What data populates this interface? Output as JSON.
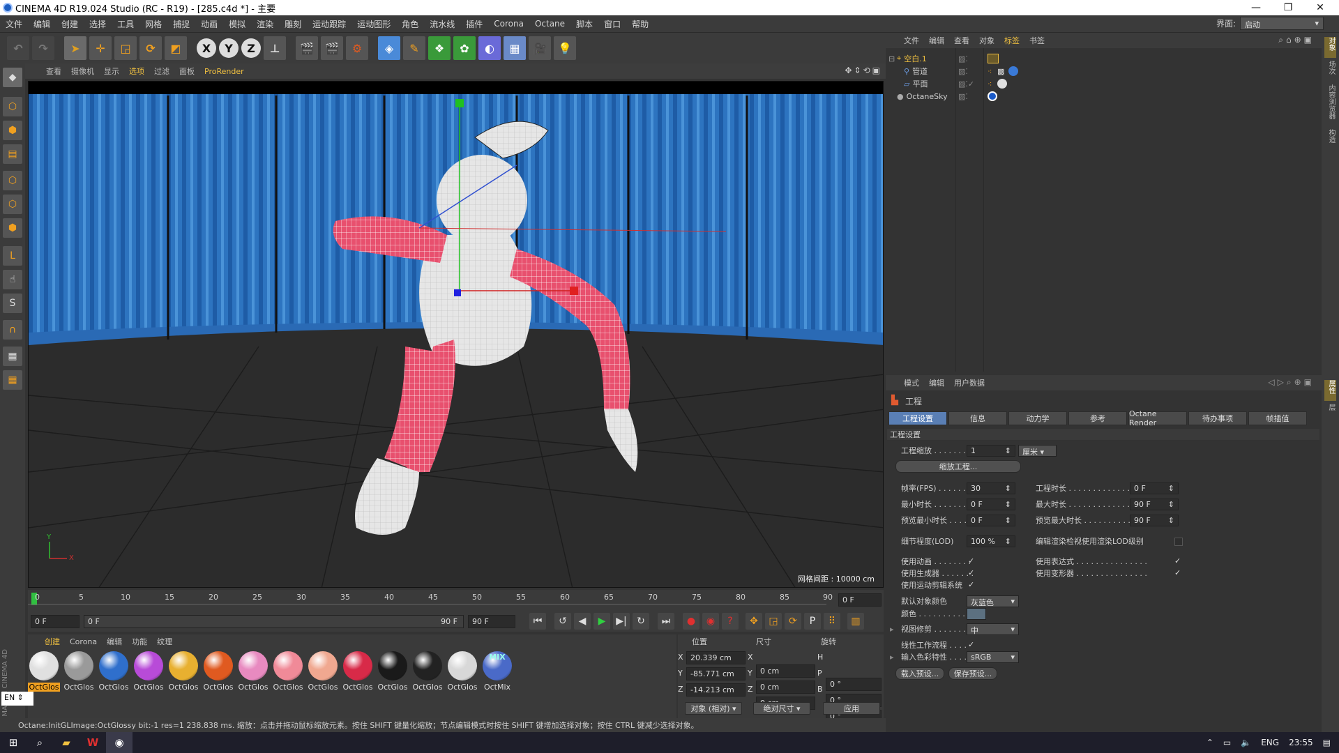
{
  "window": {
    "title": "CINEMA 4D R19.024 Studio (RC - R19) - [285.c4d *] - 主要"
  },
  "menu": {
    "items": [
      "文件",
      "编辑",
      "创建",
      "选择",
      "工具",
      "网格",
      "捕捉",
      "动画",
      "模拟",
      "渲染",
      "雕刻",
      "运动跟踪",
      "运动图形",
      "角色",
      "流水线",
      "插件",
      "Corona",
      "Octane",
      "脚本",
      "窗口",
      "帮助"
    ],
    "layout_label": "界面:",
    "layout_value": "启动"
  },
  "viewport": {
    "menu": [
      "查看",
      "摄像机",
      "显示",
      "选项",
      "过滤",
      "面板",
      "ProRender"
    ],
    "active_menu": "选项",
    "grid_info": "网格间距 : 10000 cm",
    "axis_x": "X",
    "axis_y": "Y"
  },
  "timeline": {
    "ticks": [
      "0",
      "5",
      "10",
      "15",
      "20",
      "25",
      "30",
      "35",
      "40",
      "45",
      "50",
      "55",
      "60",
      "65",
      "70",
      "75",
      "80",
      "85",
      "90"
    ],
    "current_frame": "0 F",
    "start_field": "0 F",
    "range_start": "0 F",
    "range_end": "90 F",
    "end_field": "90 F"
  },
  "materials": {
    "menu": [
      "创建",
      "Corona",
      "编辑",
      "功能",
      "纹理"
    ],
    "items": [
      {
        "label": "OctGlos",
        "color": "#e0e0e0"
      },
      {
        "label": "OctGlos",
        "color": "#9a9a9a"
      },
      {
        "label": "OctGlos",
        "color": "#2f6fcc"
      },
      {
        "label": "OctGlos",
        "color": "#b84bd8"
      },
      {
        "label": "OctGlos",
        "color": "#e8b030"
      },
      {
        "label": "OctGlos",
        "color": "#e05a20"
      },
      {
        "label": "OctGlos",
        "color": "#e88ac0"
      },
      {
        "label": "OctGlos",
        "color": "#f08a98"
      },
      {
        "label": "OctGlos",
        "color": "#f0a890"
      },
      {
        "label": "OctGlos",
        "color": "#d82a48"
      },
      {
        "label": "OctGlos",
        "color": "#1a1a1a"
      },
      {
        "label": "OctGlos",
        "color": "#222222"
      },
      {
        "label": "OctGlos",
        "color": "#d8d8d8"
      },
      {
        "label": "OctMix",
        "color": "#4a6ac8"
      }
    ],
    "mix_text": "MIX"
  },
  "coords": {
    "headers": [
      "位置",
      "尺寸",
      "旋转"
    ],
    "rows": [
      {
        "a": "X",
        "pos": "20.339 cm",
        "b": "X",
        "size": "0 cm",
        "c": "H",
        "rot": "0 °"
      },
      {
        "a": "Y",
        "pos": "-85.771 cm",
        "b": "Y",
        "size": "0 cm",
        "c": "P",
        "rot": "0 °"
      },
      {
        "a": "Z",
        "pos": "-14.213 cm",
        "b": "Z",
        "size": "0 cm",
        "c": "B",
        "rot": "0 °"
      }
    ],
    "mode1": "对象 (相对)",
    "mode2": "绝对尺寸",
    "apply": "应用"
  },
  "status": {
    "text": "Octane:InitGLImage:OctGlossy  bit:-1 res=1  238.838 ms.   缩放：点击并拖动鼠标缩放元素。按住 SHIFT 键量化缩放；节点编辑模式时按住 SHIFT 键增加选择对象；按住 CTRL 键减少选择对象。"
  },
  "objects": {
    "menu": [
      "文件",
      "编辑",
      "查看",
      "对象",
      "标签",
      "书签"
    ],
    "active_menu": "标签",
    "items": [
      {
        "name": "空白.1",
        "color": "#f0c040"
      },
      {
        "name": "管道",
        "color": "#cfcfcf"
      },
      {
        "name": "平面",
        "color": "#cfcfcf"
      },
      {
        "name": "OctaneSky",
        "color": "#cfcfcf"
      }
    ]
  },
  "attributes": {
    "menu": [
      "模式",
      "编辑",
      "用户数据"
    ],
    "object_title": "工程",
    "tabs": [
      "工程设置",
      "信息",
      "动力学",
      "参考",
      "Octane Render",
      "待办事项",
      "帧插值"
    ],
    "active_tab": "工程设置",
    "section": "工程设置",
    "scale_label": "工程缩放",
    "scale_value": "1",
    "scale_unit": "厘米",
    "scale_btn": "缩放工程...",
    "fps_label": "帧率(FPS)",
    "fps_value": "30",
    "duration_label": "工程时长",
    "duration_value": "0 F",
    "min_label": "最小时长",
    "min_value": "0 F",
    "max_label": "最大时长",
    "max_value": "90 F",
    "pmin_label": "预览最小时长",
    "pmin_value": "0 F",
    "pmax_label": "预览最大时长",
    "pmax_value": "90 F",
    "lod_label": "细节程度(LOD)",
    "lod_value": "100 %",
    "lod_check_label": "编辑渲染检视使用渲染LOD级别",
    "use_anim": "使用动画",
    "use_expr": "使用表达式",
    "use_gen": "使用生成器",
    "use_deform": "使用变形器",
    "use_motion": "使用运动剪辑系统",
    "default_color_label": "默认对象颜色",
    "default_color_value": "灰蓝色",
    "color_label": "颜色",
    "view_clip_label": "视图修剪",
    "view_clip_value": "中",
    "linear_label": "线性工作流程",
    "input_profile_label": "输入色彩特性",
    "input_profile_value": "sRGB",
    "load_preset": "载入预设...",
    "save_preset": "保存预设..."
  },
  "taskbar": {
    "lang": "ENG",
    "time": "23:55",
    "ime": "EN"
  }
}
